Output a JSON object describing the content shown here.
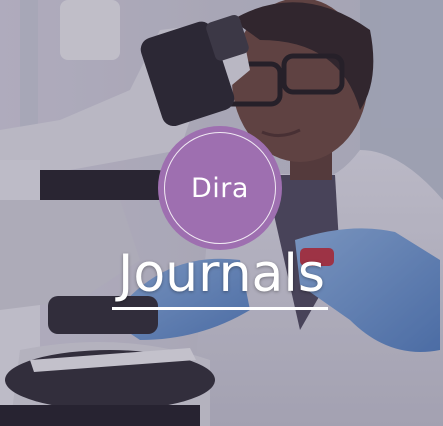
{
  "badge": {
    "text": "Dira"
  },
  "title": {
    "text": "Journals"
  },
  "colors": {
    "badge": "#9e6fb0",
    "text": "#ffffff",
    "overlay": "#463c5f"
  }
}
